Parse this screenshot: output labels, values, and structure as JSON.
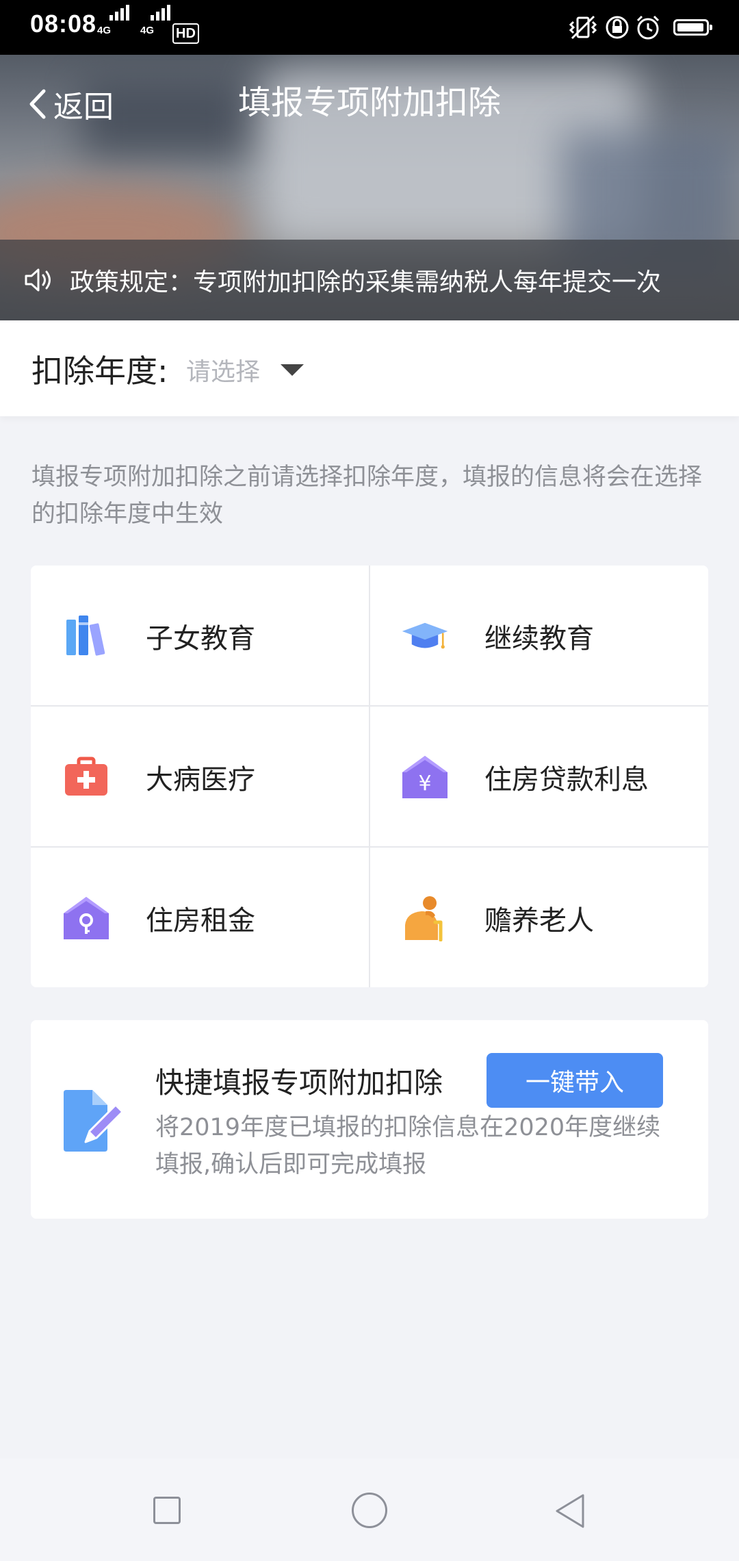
{
  "status_bar": {
    "time": "08:08",
    "net_left": "4G",
    "net_right": "4G",
    "hd": "HD"
  },
  "header": {
    "back_label": "返回",
    "title": "填报专项附加扣除",
    "notice": "政策规定：专项附加扣除的采集需纳税人每年提交一次"
  },
  "year": {
    "label": "扣除年度:",
    "placeholder": "请选择"
  },
  "hint": "填报专项附加扣除之前请选择扣除年度，填报的信息将会在选择的扣除年度中生效",
  "categories": [
    {
      "label": "子女教育",
      "icon": "books-icon"
    },
    {
      "label": "继续教育",
      "icon": "graduation-cap-icon"
    },
    {
      "label": "大病医疗",
      "icon": "medical-kit-icon"
    },
    {
      "label": "住房贷款利息",
      "icon": "house-yen-icon"
    },
    {
      "label": "住房租金",
      "icon": "house-key-icon"
    },
    {
      "label": "赡养老人",
      "icon": "elderly-person-icon"
    }
  ],
  "quick_fill": {
    "title": "快捷填报专项附加扣除",
    "button": "一键带入",
    "description": "将2019年度已填报的扣除信息在2020年度继续填报,确认后即可完成填报"
  },
  "colors": {
    "accent": "#4d8df3",
    "background": "#f2f3f7"
  }
}
